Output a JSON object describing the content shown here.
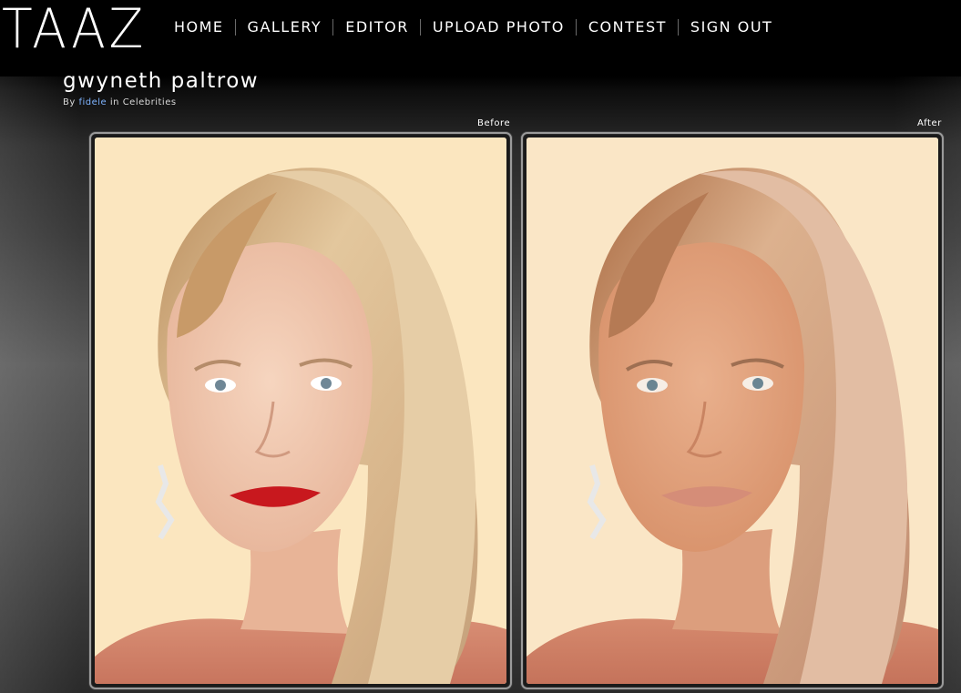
{
  "header": {
    "logo": "TAAZ",
    "nav": [
      {
        "label": "HOME"
      },
      {
        "label": "GALLERY"
      },
      {
        "label": "EDITOR"
      },
      {
        "label": "UPLOAD PHOTO"
      },
      {
        "label": "CONTEST"
      },
      {
        "label": "SIGN OUT"
      }
    ]
  },
  "photo_page": {
    "title": "gwyneth paltrow",
    "by_prefix": "By",
    "author": "fidele",
    "in_text": "in",
    "category": "Celebrities"
  },
  "panels": {
    "before_label": "Before",
    "after_label": "After"
  },
  "colors": {
    "background_top": "#000000",
    "link_blue": "#7fb4ff",
    "photo_background": "#fbe6bf",
    "hair": "#d9b98a",
    "skin_before": "#f1c8ae",
    "skin_after": "#e2a57f",
    "lips_before": "#c8181e",
    "lips_after": "#d58d78",
    "dress": "#d58b72"
  },
  "icons": {
    "logo": "taaz-wordmark"
  }
}
